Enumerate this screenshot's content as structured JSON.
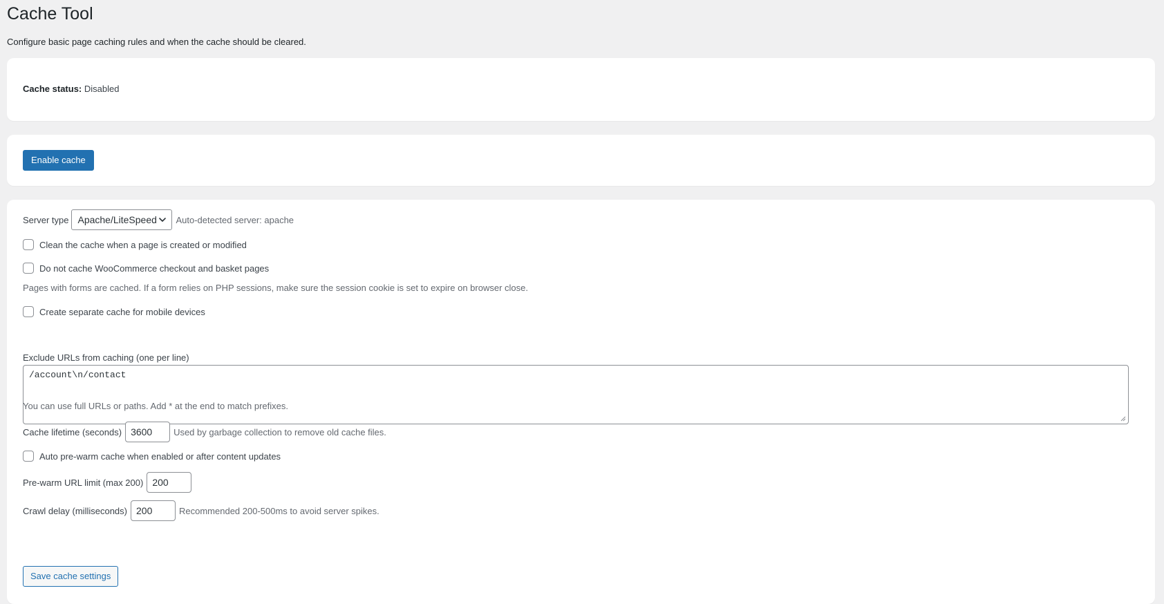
{
  "page": {
    "title": "Cache Tool",
    "description": "Configure basic page caching rules and when the cache should be cleared."
  },
  "status": {
    "label": "Cache status:",
    "value": "Disabled"
  },
  "enable": {
    "button_label": "Enable cache"
  },
  "settings": {
    "server_type": {
      "label": "Server type",
      "selected": "Apache/LiteSpeed",
      "hint": "Auto-detected server: apache"
    },
    "clean_on_modify": {
      "label": "Clean the cache when a page is created or modified",
      "checked": false
    },
    "woocommerce": {
      "label": "Do not cache WooCommerce checkout and basket pages",
      "checked": false
    },
    "forms_note": "Pages with forms are cached. If a form relies on PHP sessions, make sure the session cookie is set to expire on browser close.",
    "mobile": {
      "label": "Create separate cache for mobile devices",
      "checked": false
    },
    "exclude": {
      "label": "Exclude URLs from caching (one per line)",
      "value": "/account\\n/contact",
      "help": "You can use full URLs or paths. Add * at the end to match prefixes."
    },
    "lifetime": {
      "label": "Cache lifetime (seconds)",
      "value": "3600",
      "hint": "Used by garbage collection to remove old cache files."
    },
    "prewarm": {
      "label": "Auto pre-warm cache when enabled or after content updates",
      "checked": false
    },
    "prewarm_limit": {
      "label": "Pre-warm URL limit (max 200)",
      "value": "200"
    },
    "crawl_delay": {
      "label": "Crawl delay (milliseconds)",
      "value": "200",
      "hint": "Recommended 200-500ms to avoid server spikes."
    },
    "save_label": "Save cache settings"
  },
  "colors": {
    "background": "#f0f0f1",
    "card": "#ffffff",
    "primary": "#2271b1",
    "text": "#1d2327",
    "muted": "#646970"
  }
}
